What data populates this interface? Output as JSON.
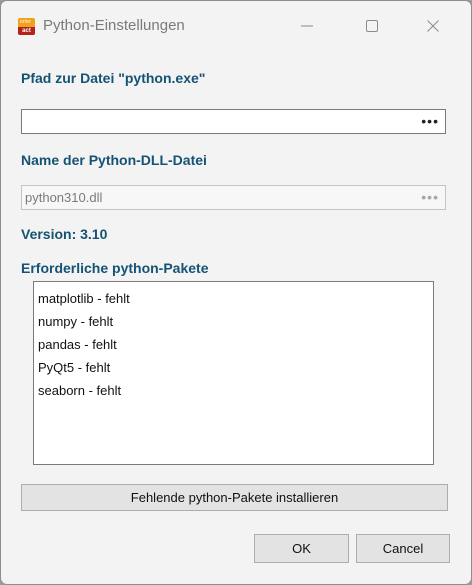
{
  "window": {
    "title": "Python-Einstellungen",
    "icon_top": "inter",
    "icon_bottom": "act"
  },
  "python_path": {
    "label": "Pfad zur Datei \"python.exe\"",
    "value": "",
    "browse_label": "•••"
  },
  "dll": {
    "label": "Name der Python-DLL-Datei",
    "value": "python310.dll",
    "browse_label": "•••"
  },
  "version_label": "Version: 3.10",
  "packages": {
    "label": "Erforderliche python-Pakete",
    "items": [
      "matplotlib - fehlt",
      "numpy - fehlt",
      "pandas - fehlt",
      "PyQt5 - fehlt",
      "seaborn - fehlt"
    ]
  },
  "buttons": {
    "install": "Fehlende python-Pakete installieren",
    "ok": "OK",
    "cancel": "Cancel"
  },
  "colors": {
    "label": "#155273",
    "icon_orange": "#f2a11c",
    "icon_red": "#b3231b"
  }
}
